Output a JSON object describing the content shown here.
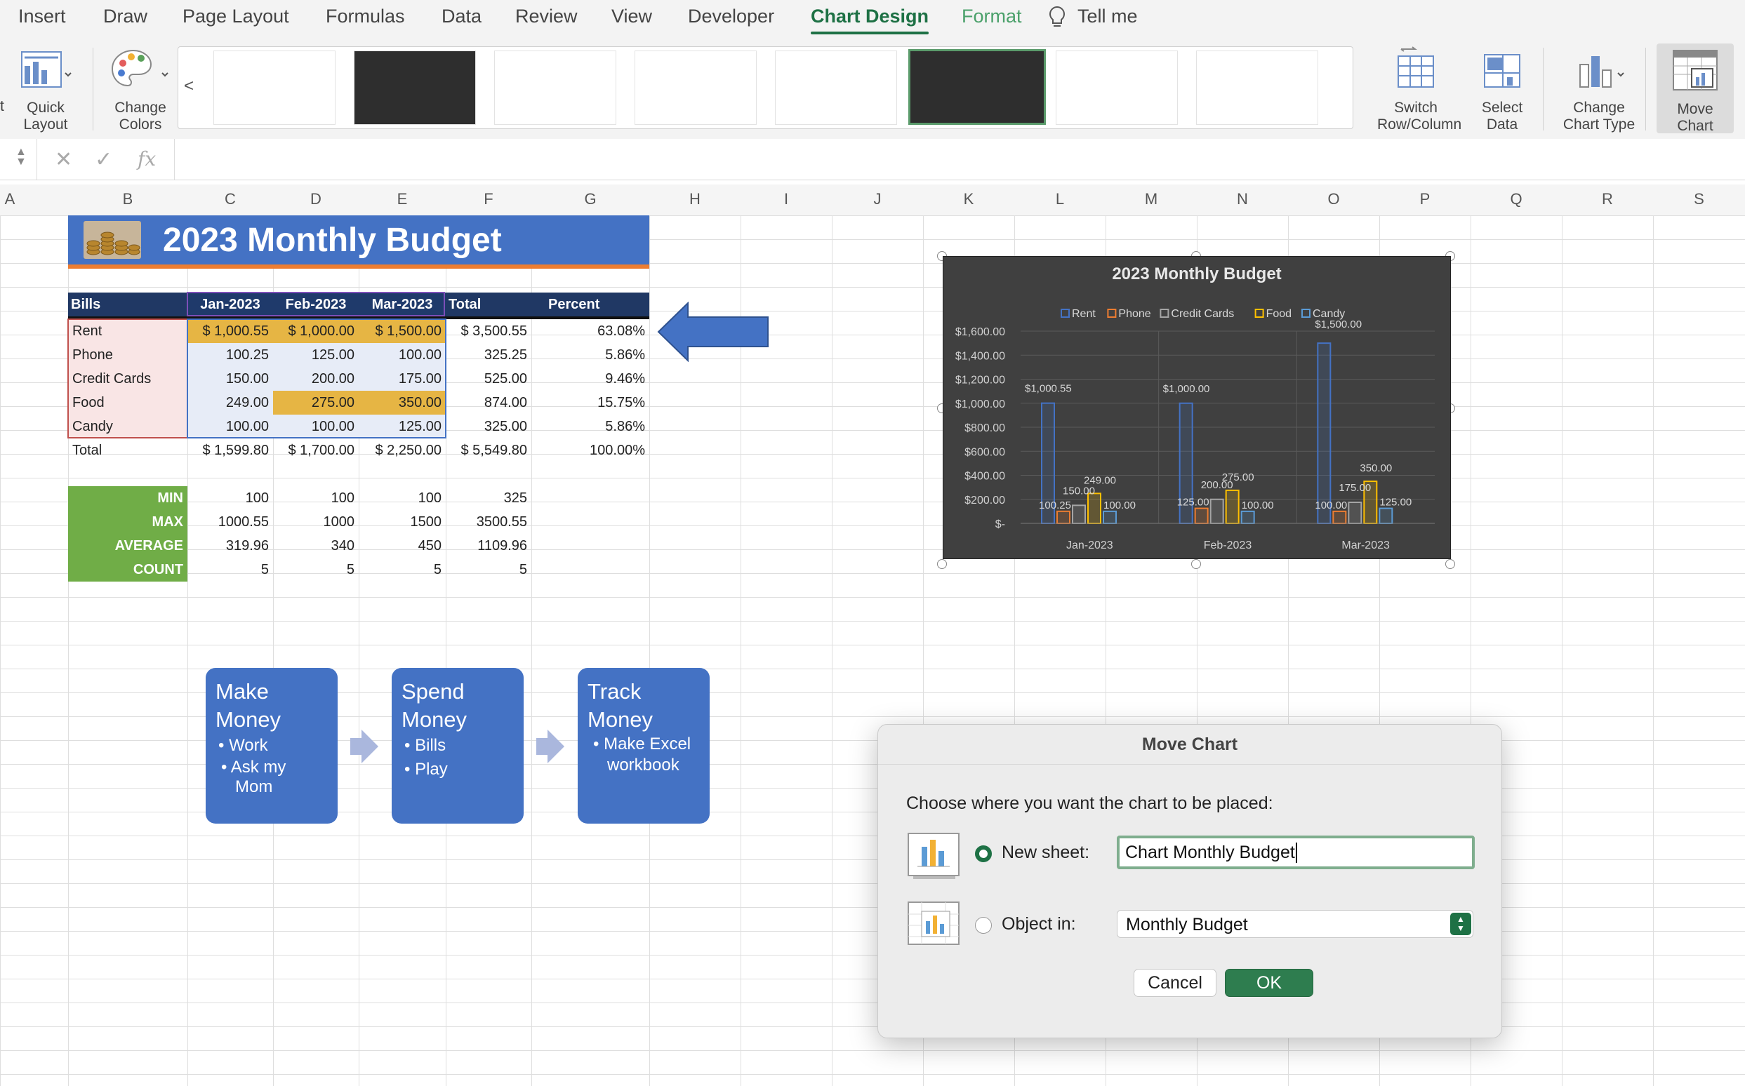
{
  "ribbon": {
    "tabs": [
      "Insert",
      "Draw",
      "Page Layout",
      "Formulas",
      "Data",
      "Review",
      "View",
      "Developer",
      "Chart Design",
      "Format",
      "Tell me"
    ],
    "active_tab": "Chart Design",
    "quick_layout": "Quick Layout",
    "change_colors": "Change Colors",
    "switch_row_col": "Switch Row/Column",
    "select_data": "Select Data",
    "change_chart_type": "Change Chart Type",
    "move_chart": "Move Chart",
    "left_cut": "t",
    "gallery_prev": "<"
  },
  "formula_bar": {
    "fx": "fx",
    "value": ""
  },
  "columns": [
    "A",
    "B",
    "C",
    "D",
    "E",
    "F",
    "G",
    "H",
    "I",
    "J",
    "K",
    "L",
    "M",
    "N",
    "O",
    "P",
    "Q",
    "R",
    "S"
  ],
  "sheet": {
    "title": "2023 Monthly Budget",
    "headers": [
      "Bills",
      "Jan-2023",
      "Feb-2023",
      "Mar-2023",
      "Total",
      "Percent"
    ],
    "rows": [
      {
        "label": "Rent",
        "jan": "$ 1,000.55",
        "feb": "$ 1,000.00",
        "mar": "$ 1,500.00",
        "total": "$ 3,500.55",
        "pct": "63.08%"
      },
      {
        "label": "Phone",
        "jan": "100.25",
        "feb": "125.00",
        "mar": "100.00",
        "total": "325.25",
        "pct": "5.86%"
      },
      {
        "label": "Credit Cards",
        "jan": "150.00",
        "feb": "200.00",
        "mar": "175.00",
        "total": "525.00",
        "pct": "9.46%"
      },
      {
        "label": "Food",
        "jan": "249.00",
        "feb": "275.00",
        "mar": "350.00",
        "total": "874.00",
        "pct": "15.75%"
      },
      {
        "label": "Candy",
        "jan": "100.00",
        "feb": "100.00",
        "mar": "125.00",
        "total": "325.00",
        "pct": "5.86%"
      }
    ],
    "total_row": {
      "label": "Total",
      "jan": "$ 1,599.80",
      "feb": "$ 1,700.00",
      "mar": "$ 2,250.00",
      "total": "$ 5,549.80",
      "pct": "100.00%"
    },
    "stats": [
      {
        "label": "MIN",
        "c": "100",
        "d": "100",
        "e": "100",
        "f": "325"
      },
      {
        "label": "MAX",
        "c": "1000.55",
        "d": "1000",
        "e": "1500",
        "f": "3500.55"
      },
      {
        "label": "AVERAGE",
        "c": "319.96",
        "d": "340",
        "e": "450",
        "f": "1109.96"
      },
      {
        "label": "COUNT",
        "c": "5",
        "d": "5",
        "e": "5",
        "f": "5"
      }
    ]
  },
  "smartart": [
    {
      "title": "Make Money",
      "items": [
        "Work",
        "Ask my Mom"
      ]
    },
    {
      "title": "Spend Money",
      "items": [
        "Bills",
        "Play"
      ]
    },
    {
      "title": "Track Money",
      "items": [
        "Make Excel workbook"
      ]
    }
  ],
  "chart_data": {
    "type": "bar",
    "title": "2023 Monthly Budget",
    "categories": [
      "Jan-2023",
      "Feb-2023",
      "Mar-2023"
    ],
    "series": [
      {
        "name": "Rent",
        "color": "#4472c4",
        "values": [
          1000.55,
          1000.0,
          1500.0
        ],
        "labels": [
          "$1,000.55",
          "$1,000.00",
          "$1,500.00"
        ]
      },
      {
        "name": "Phone",
        "color": "#ed7d31",
        "values": [
          100.25,
          125.0,
          100.0
        ],
        "labels": [
          "100.25",
          "125.00",
          "100.00"
        ]
      },
      {
        "name": "Credit Cards",
        "color": "#a5a5a5",
        "values": [
          150.0,
          200.0,
          175.0
        ],
        "labels": [
          "150.00",
          "200.00",
          "175.00"
        ]
      },
      {
        "name": "Food",
        "color": "#ffc000",
        "values": [
          249.0,
          275.0,
          350.0
        ],
        "labels": [
          "249.00",
          "275.00",
          "350.00"
        ]
      },
      {
        "name": "Candy",
        "color": "#5b9bd5",
        "values": [
          100.0,
          100.0,
          125.0
        ],
        "labels": [
          "100.00",
          "100.00",
          "125.00"
        ]
      }
    ],
    "yticks": [
      "$-",
      "$200.00",
      "$400.00",
      "$600.00",
      "$800.00",
      "$1,000.00",
      "$1,200.00",
      "$1,400.00",
      "$1,600.00"
    ],
    "ylim": [
      0,
      1600
    ],
    "legend": "top",
    "grid": true
  },
  "dialog": {
    "title": "Move Chart",
    "prompt": "Choose where you want the chart to be placed:",
    "new_sheet_label": "New sheet:",
    "new_sheet_value": "Chart Monthly Budget",
    "object_in_label": "Object in:",
    "object_in_value": "Monthly Budget",
    "cancel": "Cancel",
    "ok": "OK"
  },
  "colors": {
    "accent": "#1e7145",
    "header_blue": "#4472c4",
    "header_dark": "#203864",
    "stat_green": "#70ad47",
    "highlight": "#e6b544"
  }
}
